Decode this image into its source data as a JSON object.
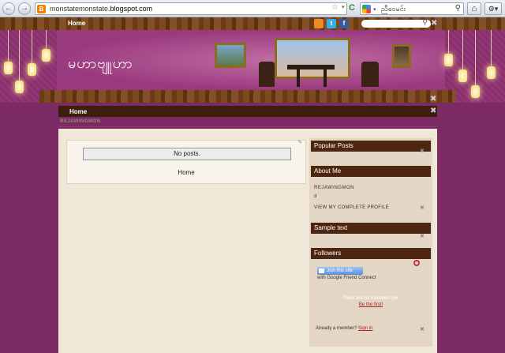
{
  "browser": {
    "url_prefix": "monstatemonstate.",
    "url_host": "blogspot.com",
    "search_text": "ညီဝေမင်း",
    "favicon_letter": "B",
    "back_glyph": "←",
    "forward_glyph": "→",
    "star_glyph": "☆",
    "reload_glyph": "C",
    "search_glyph": "⚲",
    "home_glyph": "⌂",
    "tools_glyph": "⚙▾",
    "dropdown_glyph": "▾"
  },
  "blog": {
    "title": "မဟာဗျူဟာ",
    "top_nav_home": "Home",
    "social_rss": "",
    "social_twitter": "t",
    "social_facebook": "f",
    "wrench_glyph": "✖",
    "search_glyph": "⚲",
    "nav_home": "Home",
    "breadcrumb": "REJAWINGMON",
    "posts_message": "No posts.",
    "main_home_link": "Home"
  },
  "sidebar": {
    "popular_posts": "Popular Posts",
    "about_me": "About Me",
    "author_name": "REJAWINGMON",
    "author_desc": "d",
    "view_profile": "VIEW MY COMPLETE PROFILE",
    "sample_text": "Sample text",
    "followers": "Followers",
    "join_label": "Join this site",
    "gfc_text": "with Google Friend Connect",
    "no_members": "There are no members yet.",
    "be_first": "Be the first!",
    "already_member": "Already a member?",
    "sign_in": "Sign in"
  },
  "colors": {
    "wall": "#9a3a7e",
    "wood": "#7c4a1e",
    "widget_header": "#4d2610",
    "content_bg": "#efe8d9"
  }
}
